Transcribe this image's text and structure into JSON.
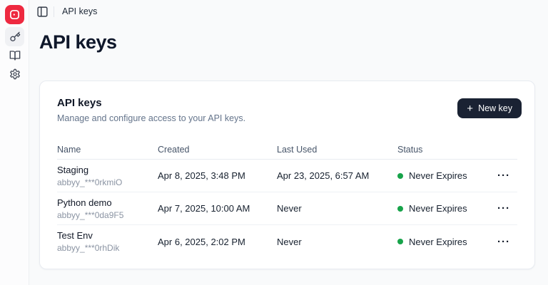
{
  "topbar": {
    "breadcrumb": "API keys"
  },
  "sidebar": {
    "items": [
      {
        "id": "api-keys",
        "icon": "key-icon",
        "active": true
      },
      {
        "id": "docs",
        "icon": "book-icon",
        "active": false
      },
      {
        "id": "settings",
        "icon": "gear-icon",
        "active": false
      }
    ]
  },
  "page": {
    "title": "API keys"
  },
  "card": {
    "title": "API keys",
    "subtitle": "Manage and configure access to your API keys.",
    "new_key_button": {
      "plus": "+",
      "label": "New key"
    }
  },
  "table": {
    "headers": [
      "Name",
      "Created",
      "Last Used",
      "Status"
    ],
    "rows": [
      {
        "name": "Staging",
        "key": "abbyy_***0rkmiO",
        "created": "Apr 8, 2025, 3:48 PM",
        "last_used": "Apr 23, 2025, 6:57 AM",
        "status": "Never Expires"
      },
      {
        "name": "Python demo",
        "key": "abbyy_***0da9F5",
        "created": "Apr 7, 2025, 10:00 AM",
        "last_used": "Never",
        "status": "Never Expires"
      },
      {
        "name": "Test Env",
        "key": "abbyy_***0rhDik",
        "created": "Apr 6, 2025, 2:02 PM",
        "last_used": "Never",
        "status": "Never Expires"
      }
    ]
  },
  "icons": {
    "more": "···"
  },
  "colors": {
    "accent_red": "#ee2940",
    "button_bg": "#1a2233",
    "status_green": "#17a34a"
  }
}
